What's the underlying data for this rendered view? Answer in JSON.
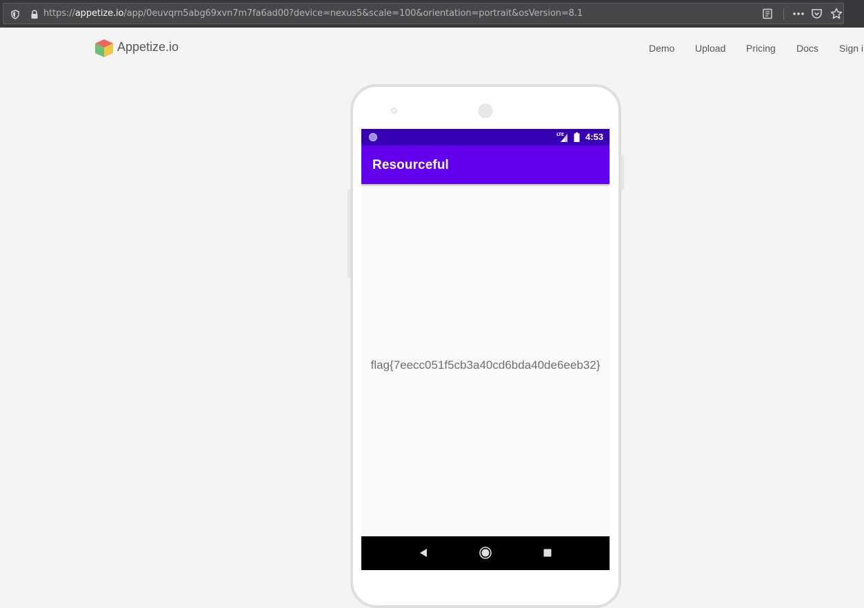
{
  "browser": {
    "url_prefix": "https://",
    "url_host": "appetize.io",
    "url_path": "/app/0euvqrn5abg69xvn7m7fa6ad00?device=nexus5&scale=100&orientation=portrait&osVersion=8.1",
    "icons": [
      "shield-icon",
      "lock-icon",
      "reader-icon",
      "more-icon",
      "pocket-icon",
      "star-icon"
    ]
  },
  "site": {
    "name": "Appetize.io",
    "nav": [
      "Demo",
      "Upload",
      "Pricing",
      "Docs",
      "Sign i"
    ]
  },
  "device": {
    "status_time": "4:53",
    "network_label": "LTE",
    "app_title": "Resourceful",
    "content_text": "flag{7eecc051f5cb3a40cd6bda40de6eeb32}",
    "nav_icons": [
      "back-icon",
      "home-icon",
      "recents-icon"
    ]
  },
  "colors": {
    "status_bar": "#3700b3",
    "app_bar": "#6200ee",
    "page_bg": "#f4f4f4",
    "browser_bar": "#38383d"
  }
}
